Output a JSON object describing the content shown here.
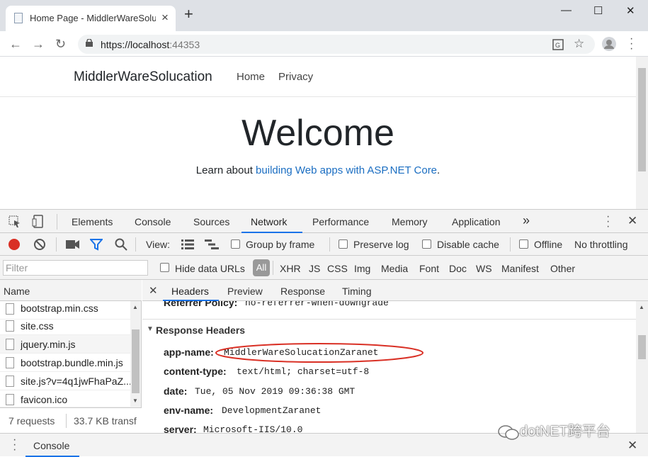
{
  "browser": {
    "tab_title": "Home Page - MiddlerWareSolucation",
    "url_host": "https://localhost",
    "url_port": ":44353",
    "close_icon": "×",
    "newtab_icon": "+",
    "window_minimize": "—",
    "window_maximize": "☐",
    "window_close": "✕"
  },
  "page": {
    "brand": "MiddlerWareSolucation",
    "nav_home": "Home",
    "nav_privacy": "Privacy",
    "welcome": "Welcome",
    "learn_prefix": "Learn about ",
    "learn_link": "building Web apps with ASP.NET Core",
    "learn_suffix": "."
  },
  "devtools": {
    "tabs": [
      "Elements",
      "Console",
      "Sources",
      "Network",
      "Performance",
      "Memory",
      "Application"
    ],
    "more": "»",
    "view_label": "View:",
    "group_by_frame": "Group by frame",
    "preserve_log": "Preserve log",
    "disable_cache": "Disable cache",
    "offline": "Offline",
    "throttling": "No throttling",
    "filter_placeholder": "Filter",
    "hide_data_urls": "Hide data URLs",
    "type_filters": [
      "All",
      "XHR",
      "JS",
      "CSS",
      "Img",
      "Media",
      "Font",
      "Doc",
      "WS",
      "Manifest",
      "Other"
    ],
    "name_header": "Name",
    "requests": [
      "bootstrap.min.css",
      "site.css",
      "jquery.min.js",
      "bootstrap.bundle.min.js",
      "site.js?v=4q1jwFhaPaZ...",
      "favicon.ico"
    ],
    "status_requests": "7 requests",
    "status_transfer": "33.7 KB transf",
    "detail_tabs": [
      "Headers",
      "Preview",
      "Response",
      "Timing"
    ],
    "referrer_line_key": "Referrer Policy:",
    "referrer_line_val": "no-referrer-when-downgrade",
    "response_headers_title": "Response Headers",
    "headers": [
      {
        "key": "app-name:",
        "value": "MiddlerWareSolucationZaranet"
      },
      {
        "key": "content-type:",
        "value": "text/html; charset=utf-8"
      },
      {
        "key": "date:",
        "value": "Tue, 05 Nov 2019 09:36:38 GMT"
      },
      {
        "key": "env-name:",
        "value": "DevelopmentZaranet"
      },
      {
        "key": "server:",
        "value": "Microsoft-IIS/10.0"
      }
    ],
    "drawer_tab": "Console"
  },
  "watermark": "dotNET跨平台",
  "colors": {
    "link": "#1b6ec2",
    "accent": "#1a73e8",
    "record": "#d93025",
    "highlight_circle": "#d93025"
  }
}
